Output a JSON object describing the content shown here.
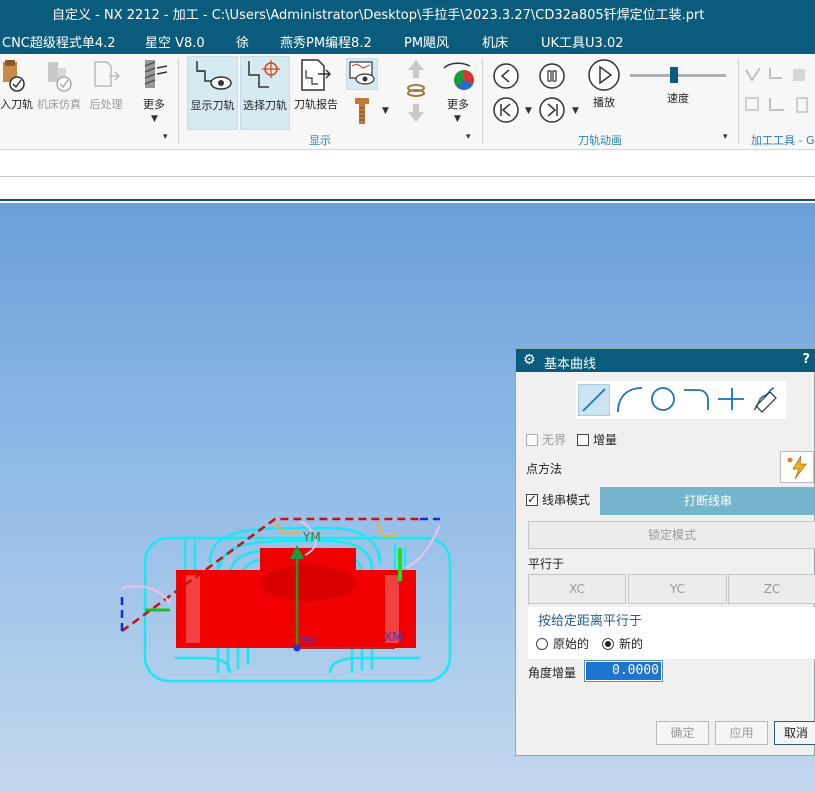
{
  "window": {
    "title": "自定义 - NX 2212 - 加工 - C:\\Users\\Administrator\\Desktop\\手拉手\\2023.3.27\\CD32a805钎焊定位工装.prt"
  },
  "menu": [
    "CNC超级程式单4.2",
    "星空 V8.0",
    "徐",
    "燕秀PM编程8.2",
    "PM飓风",
    "机床",
    "UK工具U3.02"
  ],
  "ribbon": {
    "toolpath_group": {
      "label_import": "入刀轨",
      "label_machine_sim": "机床仿真",
      "label_post": "后处理",
      "label_more": "更多"
    },
    "display_group": {
      "label": "显示",
      "show_toolpath": "显示刀轨",
      "select_toolpath": "选择刀轨",
      "toolpath_report": "刀轨报告",
      "more": "更多"
    },
    "animation_group": {
      "label": "刀轨动画",
      "play": "播放",
      "speed": "速度",
      "speed_level": 0.45
    },
    "tools_group": {
      "label": "加工工具 - G"
    }
  },
  "viewport": {
    "axis_y": "YM",
    "axis_x": "XM",
    "axis_origin": "ZM"
  },
  "dialog": {
    "title": "基本曲线",
    "help": "?",
    "curve_types": [
      "line",
      "arc",
      "circle",
      "fillet",
      "trim",
      "edit"
    ],
    "unbounded_label": "无界",
    "unbounded_checked": false,
    "incremental_label": "增量",
    "incremental_checked": false,
    "point_method_label": "点方法",
    "string_mode_label": "线串模式",
    "string_mode_checked": true,
    "break_string_label": "打断线串",
    "lock_mode_label": "锁定模式",
    "parallel_to_label": "平行于",
    "axis_buttons": [
      "XC",
      "YC",
      "ZC"
    ],
    "parallel_distance_label": "按给定距离平行于",
    "radio_original": "原始的",
    "radio_new": "新的",
    "radio_selected": "new",
    "angle_increment_label": "角度增量",
    "angle_increment_value": "0.0000",
    "ok_label": "确定",
    "apply_label": "应用",
    "cancel_label": "取消"
  },
  "colors": {
    "accent": "#0b5c7c",
    "break_button": "#76b6cc",
    "toolpath_cyan": "#17e8f2",
    "part_red": "#f00000"
  }
}
